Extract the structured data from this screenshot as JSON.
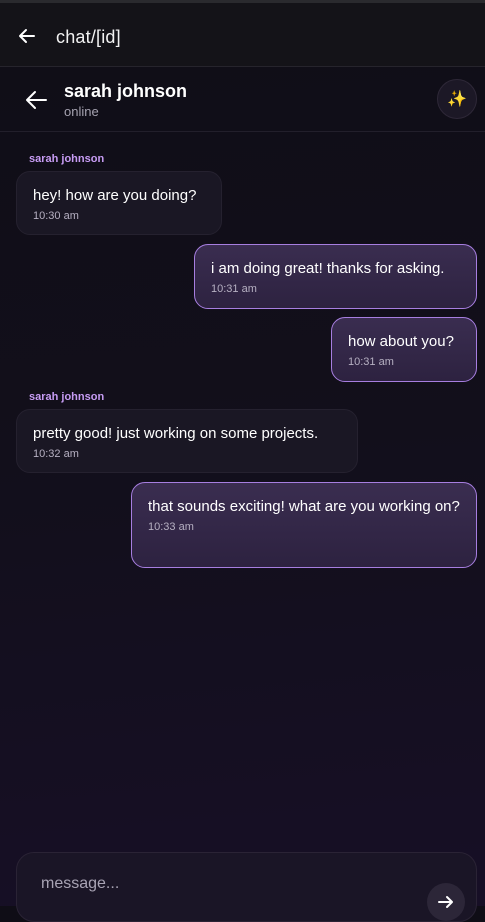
{
  "topbar": {
    "title": "chat/[id]",
    "back_icon": "arrow-left-icon"
  },
  "header": {
    "name": "sarah johnson",
    "status": "online",
    "magic_icon": "sparkles-icon"
  },
  "messages": [
    {
      "direction": "in",
      "sender": "sarah johnson",
      "text": "hey! how are you doing?",
      "time": "10:30 am"
    },
    {
      "direction": "out",
      "text": "i am doing great! thanks for asking.",
      "time": "10:31 am"
    },
    {
      "direction": "out",
      "text": "how about you?",
      "time": "10:31 am"
    },
    {
      "direction": "in",
      "sender": "sarah johnson",
      "text": "pretty good! just working on some projects.",
      "time": "10:32 am"
    },
    {
      "direction": "out",
      "text": "that sounds exciting! what are you working on?",
      "time": "10:33 am"
    }
  ],
  "composer": {
    "placeholder": "message...",
    "value": "",
    "send_icon": "arrow-right-icon"
  },
  "colors": {
    "accent": "#a77ee0",
    "sender_name": "#c79cf4",
    "background": "#0f0d16"
  }
}
